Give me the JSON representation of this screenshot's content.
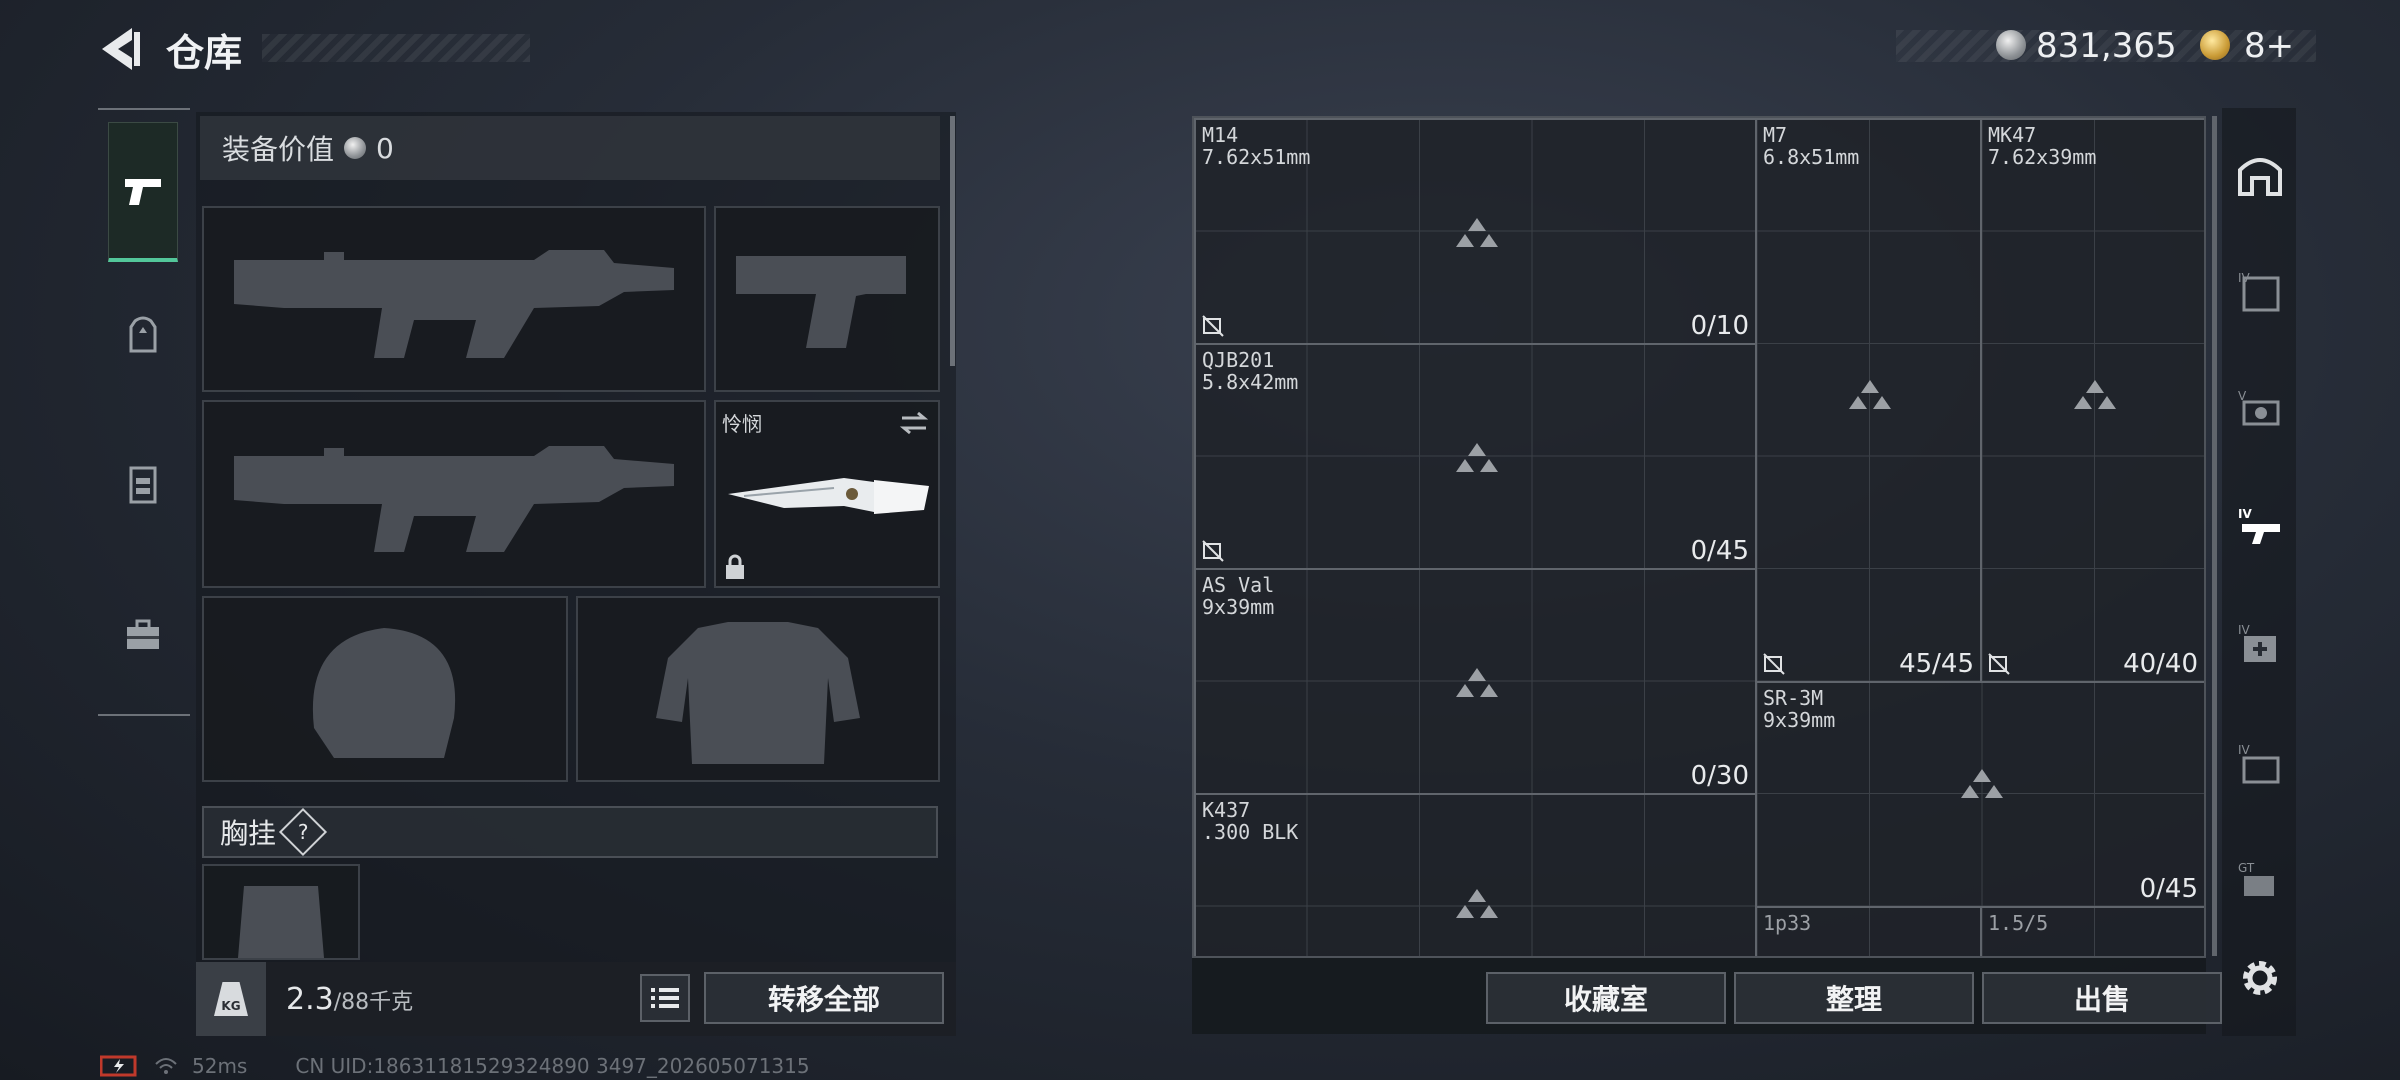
{
  "header": {
    "title": "仓库",
    "silver": "831,365",
    "gold": "8+"
  },
  "left": {
    "value_label": "装备价值",
    "value": "0",
    "melee_name": "怜悯",
    "vest_label": "胸挂",
    "vest_help": "?",
    "weight_current": "2.3",
    "weight_max": "/88千克",
    "weight_icon_text": "KG",
    "transfer_all": "转移全部"
  },
  "grid": {
    "cells": [
      {
        "name": "M14",
        "caliber": "7.62x51mm",
        "count": "0/10"
      },
      {
        "name": "QJB201",
        "caliber": "5.8x42mm",
        "count": "0/45"
      },
      {
        "name": "AS Val",
        "caliber": "9x39mm",
        "count": "0/30"
      },
      {
        "name": "K437",
        "caliber": ".300 BLK",
        "count": ""
      },
      {
        "name": "M7",
        "caliber": "6.8x51mm",
        "count": "45/45"
      },
      {
        "name": "MK47",
        "caliber": "7.62x39mm",
        "count": "40/40"
      },
      {
        "name": "SR-3M",
        "caliber": "9x39mm",
        "count": "0/45"
      },
      {
        "name": "1p33",
        "caliber": "",
        "count": ""
      },
      {
        "name": "1.5/5",
        "caliber": "",
        "count": ""
      }
    ]
  },
  "bottom": {
    "collection": "收藏室",
    "sort": "整理",
    "sell": "出售"
  },
  "status": {
    "ping": "52ms",
    "uid": "CN UID:18631181529324890 3497_202605071315"
  }
}
